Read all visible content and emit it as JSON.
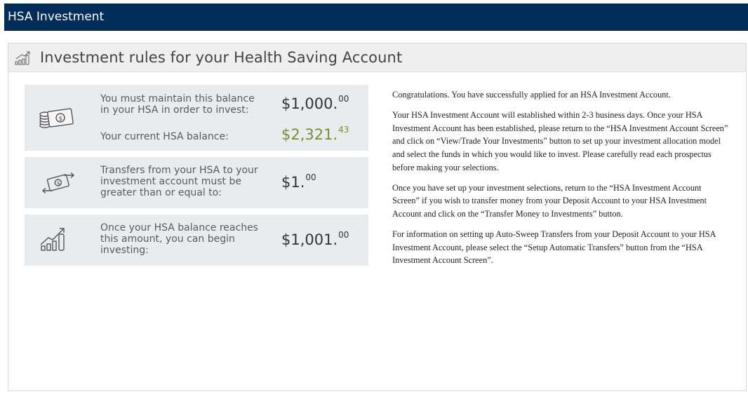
{
  "header": {
    "title": "HSA Investment"
  },
  "panel": {
    "title": "Investment rules for your Health Saving Account",
    "title_icon": "growth-chart-icon"
  },
  "cards": [
    {
      "icon": "money-stack-icon",
      "rows": [
        {
          "label": "You must maintain this balance in your HSA in order to invest:",
          "amount_main": "$1,000.",
          "amount_cents": "00"
        },
        {
          "label": "Your current HSA balance:",
          "amount_main": "$2,321.",
          "amount_cents": "43"
        }
      ]
    },
    {
      "icon": "transfer-money-icon",
      "rows": [
        {
          "label": "Transfers from your HSA to your investment account must be greater than or equal to:",
          "amount_main": "$1.",
          "amount_cents": "00"
        }
      ]
    },
    {
      "icon": "growth-chart-icon",
      "rows": [
        {
          "label": "Once your HSA balance reaches this amount, you can begin investing:",
          "amount_main": "$1,001.",
          "amount_cents": "00"
        }
      ]
    }
  ],
  "colors": {
    "header_bg": "#002d5a",
    "current_balance": "#7c8d26",
    "card_bg": "#e9ecef"
  },
  "info": {
    "p1": "Congratulations. You have successfully applied for an HSA Investment Account.",
    "p2": "Your HSA Investment Account will established within 2-3 business days. Once your HSA Investment Account has been established, please return to the “HSA Investment Account Screen” and click on “View/Trade Your Investments” button to set up your investment allocation model and select the funds in which you would like to invest. Please carefully read each prospectus before making your selections.",
    "p3": "Once you have set up your investment selections, return to the “HSA Investment Account Screen” if you wish to transfer money from your Deposit Account to your HSA Investment Account and click on the “Transfer Money to Investments” button.",
    "p4": "For information on setting up Auto-Sweep Transfers from your Deposit Account to your HSA Investment Account, please select the “Setup Automatic Transfers” button from the “HSA Investment Account Screen”."
  }
}
